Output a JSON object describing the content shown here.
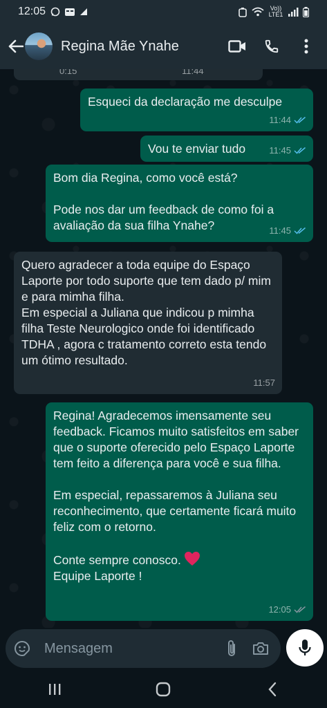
{
  "status_bar": {
    "time": "12:05",
    "network": "Vo)) LTE1"
  },
  "header": {
    "contact_name": "Regina Mãe Ynahe"
  },
  "partial_message": {
    "duration": "0:15",
    "time": "11:44"
  },
  "messages": [
    {
      "direction": "out",
      "text": "Esqueci da declaração me desculpe",
      "time": "11:44",
      "status": "read"
    },
    {
      "direction": "out",
      "text": "Vou te enviar tudo",
      "time": "11:45",
      "status": "read"
    },
    {
      "direction": "out",
      "text": "Bom dia Regina, como você está?\n\nPode nos dar um feedback de como foi a avaliação  da sua filha Ynahe?",
      "time": "11:45",
      "status": "read"
    },
    {
      "direction": "in",
      "text": "Quero agradecer a toda equipe do Espaço Laporte por todo suporte que tem dado p/ mim e para mimha filha.\nEm especial a Juliana que   indicou p mimha filha Teste Neurologico onde foi identificado TDHA , agora c tratamento correto esta tendo um ótimo resultado.",
      "time": "11:57"
    },
    {
      "direction": "out",
      "text": "Regina! Agradecemos imensamente seu feedback. Ficamos muito satisfeitos em saber que o suporte oferecido pelo Espaço Laporte tem feito a diferença para você e sua filha.\n\nEm especial, repassaremos à Juliana seu reconhecimento, que certamente ficará muito feliz com o retorno.\n\nConte sempre conosco.",
      "text_tail": "Equipe Laporte !",
      "time": "12:05",
      "status": "delivered"
    }
  ],
  "composer": {
    "placeholder": "Mensagem"
  },
  "colors": {
    "outgoing_bubble": "#005c4b",
    "incoming_bubble": "#202c33",
    "read_ticks": "#53bdeb",
    "delivered_ticks": "#8696a0",
    "heart": "#e0245e"
  }
}
